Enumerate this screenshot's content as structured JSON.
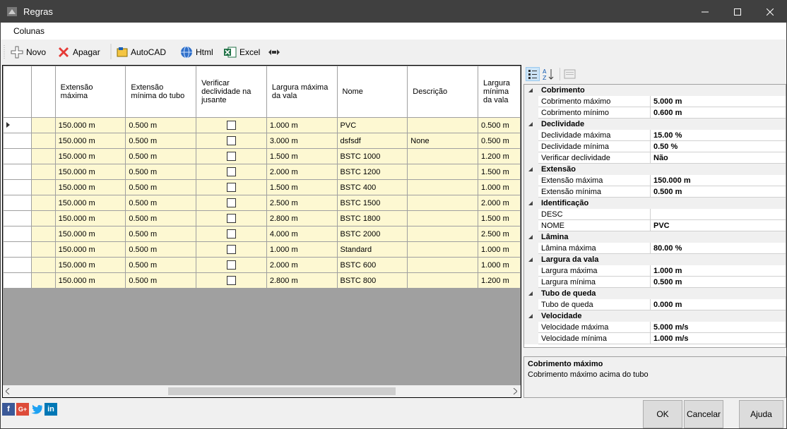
{
  "window": {
    "title": "Regras"
  },
  "menu": {
    "colunas": "Colunas"
  },
  "toolbar": {
    "novo": "Novo",
    "apagar": "Apagar",
    "autocad": "AutoCAD",
    "html": "Html",
    "excel": "Excel"
  },
  "grid": {
    "headers": [
      "Extensão máxima",
      "Extensão mínima do tubo",
      "Verificar declividade na jusante",
      "Largura máxima da vala",
      "Nome",
      "Descrição",
      "Largura mínima da vala"
    ],
    "rows": [
      [
        "150.000 m",
        "0.500 m",
        "",
        "1.000 m",
        "PVC",
        "",
        "0.500 m"
      ],
      [
        "150.000 m",
        "0.500 m",
        "",
        "3.000 m",
        "dsfsdf",
        "None",
        "0.500 m"
      ],
      [
        "150.000 m",
        "0.500 m",
        "",
        "1.500 m",
        "BSTC 1000",
        "",
        "1.200 m"
      ],
      [
        "150.000 m",
        "0.500 m",
        "",
        "2.000 m",
        "BSTC 1200",
        "",
        "1.500 m"
      ],
      [
        "150.000 m",
        "0.500 m",
        "",
        "1.500 m",
        "BSTC 400",
        "",
        "1.000 m"
      ],
      [
        "150.000 m",
        "0.500 m",
        "",
        "2.500 m",
        "BSTC 1500",
        "",
        "2.000 m"
      ],
      [
        "150.000 m",
        "0.500 m",
        "",
        "2.800 m",
        "BSTC 1800",
        "",
        "1.500 m"
      ],
      [
        "150.000 m",
        "0.500 m",
        "",
        "4.000 m",
        "BSTC 2000",
        "",
        "2.500 m"
      ],
      [
        "150.000 m",
        "0.500 m",
        "",
        "1.000 m",
        "Standard",
        "",
        "1.000 m"
      ],
      [
        "150.000 m",
        "0.500 m",
        "",
        "2.000 m",
        "BSTC 600",
        "",
        "1.000 m"
      ],
      [
        "150.000 m",
        "0.500 m",
        "",
        "2.800 m",
        "BSTC 800",
        "",
        "1.200 m"
      ]
    ]
  },
  "properties": [
    {
      "category": "Cobrimento",
      "items": [
        [
          "Cobrimento máximo",
          "5.000 m"
        ],
        [
          "Cobrimento mínimo",
          "0.600 m"
        ]
      ]
    },
    {
      "category": "Declividade",
      "items": [
        [
          "Declividade máxima",
          "15.00 %"
        ],
        [
          "Declividade mínima",
          "0.50 %"
        ],
        [
          "Verificar declividade",
          "Não"
        ]
      ]
    },
    {
      "category": "Extensão",
      "items": [
        [
          "Extensão máxima",
          "150.000 m"
        ],
        [
          "Extensão mínima",
          "0.500 m"
        ]
      ]
    },
    {
      "category": "Identificação",
      "items": [
        [
          "DESC",
          ""
        ],
        [
          "NOME",
          "PVC"
        ]
      ]
    },
    {
      "category": "Lâmina",
      "items": [
        [
          "Lâmina máxima",
          "80.00 %"
        ]
      ]
    },
    {
      "category": "Largura da vala",
      "items": [
        [
          "Largura máxima",
          "1.000 m"
        ],
        [
          "Largura mínima",
          "0.500 m"
        ]
      ]
    },
    {
      "category": "Tubo de queda",
      "items": [
        [
          "Tubo de queda",
          "0.000 m"
        ]
      ]
    },
    {
      "category": "Velocidade",
      "items": [
        [
          "Velocidade máxima",
          "5.000 m/s"
        ],
        [
          "Velocidade mínima",
          "1.000 m/s"
        ]
      ]
    }
  ],
  "description": {
    "title": "Cobrimento máximo",
    "text": "Cobrimento máximo acima do tubo"
  },
  "social": {
    "facebook": "f",
    "googleplus": "G+",
    "linkedin": "in"
  },
  "buttons": {
    "ok": "OK",
    "cancelar": "Cancelar",
    "ajuda": "Ajuda"
  }
}
